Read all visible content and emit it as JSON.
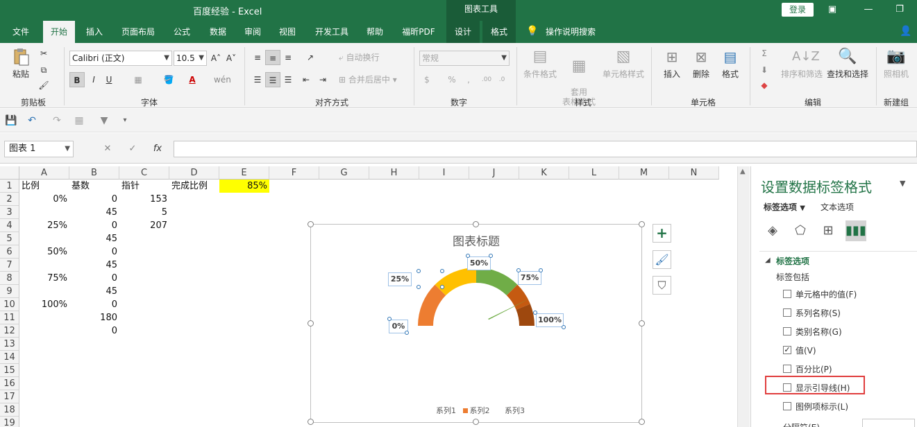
{
  "titlebar": {
    "title": "百度经验  -  Excel",
    "context_tools": "图表工具",
    "login": "登录"
  },
  "tabs": [
    "文件",
    "开始",
    "插入",
    "页面布局",
    "公式",
    "数据",
    "审阅",
    "视图",
    "开发工具",
    "帮助",
    "福昕PDF",
    "设计",
    "格式",
    "操作说明搜索"
  ],
  "ribbon": {
    "clipboard": {
      "paste": "粘贴",
      "group": "剪贴板"
    },
    "font": {
      "name": "Calibri (正文)",
      "size": "10.5",
      "bold": "B",
      "italic": "I",
      "underline": "U",
      "group": "字体"
    },
    "align": {
      "wrap": "自动换行",
      "merge": "合并后居中",
      "group": "对齐方式"
    },
    "number": {
      "format": "常规",
      "group": "数字"
    },
    "styles": {
      "cond": "条件格式",
      "table": "套用\n表格格式",
      "cell": "单元格样式",
      "group": "样式"
    },
    "cells": {
      "insert": "插入",
      "delete": "删除",
      "format": "格式",
      "group": "单元格"
    },
    "edit": {
      "sort": "排序和筛选",
      "find": "查找和选择",
      "group": "编辑"
    },
    "camera": {
      "label": "照相机",
      "group": "新建组"
    }
  },
  "formula_bar": {
    "name_box": "图表 1",
    "fx": "fx"
  },
  "columns": [
    "A",
    "B",
    "C",
    "D",
    "E",
    "F",
    "G",
    "H",
    "I",
    "J",
    "K",
    "L",
    "M",
    "N"
  ],
  "rows": [
    "1",
    "2",
    "3",
    "4",
    "5",
    "6",
    "7",
    "8",
    "9",
    "10",
    "11",
    "12",
    "13",
    "14",
    "15",
    "16",
    "17",
    "18",
    "19"
  ],
  "cells": {
    "A1": "比例",
    "B1": "基数",
    "C1": "指针",
    "D1": "完成比例",
    "E1": "85%",
    "A2": "0%",
    "B2": "0",
    "C2": "153",
    "B3": "45",
    "C3": "5",
    "A4": "25%",
    "B4": "0",
    "C4": "207",
    "B5": "45",
    "A6": "50%",
    "B6": "0",
    "B7": "45",
    "A8": "75%",
    "B8": "0",
    "B9": "45",
    "A10": "100%",
    "B10": "0",
    "B11": "180",
    "B12": "0"
  },
  "chart": {
    "title": "图表标题",
    "labels": [
      "0%",
      "25%",
      "50%",
      "75%",
      "100%"
    ],
    "legend": [
      "系列1",
      "系列2",
      "系列3"
    ],
    "colors": {
      "s1": "#ed7d31",
      "s2": "#ffc000",
      "s3": "#70ad47",
      "s4": "#c55a11",
      "s5": "#9e480e",
      "needle": "#70ad47"
    }
  },
  "chart_data": {
    "type": "doughnut",
    "title": "图表标题",
    "categories": [
      "0%",
      "25%",
      "50%",
      "75%",
      "100%"
    ],
    "series": [
      {
        "name": "系列1",
        "values": [
          0,
          45,
          0,
          45,
          0,
          45,
          0,
          45,
          0,
          180,
          0
        ]
      },
      {
        "name": "系列2",
        "values": []
      },
      {
        "name": "系列3",
        "values": [
          153,
          5,
          207
        ]
      }
    ]
  },
  "pane": {
    "title": "设置数据标签格式",
    "tab1": "标签选项",
    "tab2": "文本选项",
    "section": "标签选项",
    "subsection": "标签包括",
    "options": [
      {
        "label": "单元格中的值(F)",
        "checked": false
      },
      {
        "label": "系列名称(S)",
        "checked": false
      },
      {
        "label": "类别名称(G)",
        "checked": false
      },
      {
        "label": "值(V)",
        "checked": true
      },
      {
        "label": "百分比(P)",
        "checked": false
      },
      {
        "label": "显示引导线(H)",
        "checked": false
      },
      {
        "label": "图例项标示(L)",
        "checked": false
      }
    ],
    "separator": "分隔符(E)"
  }
}
